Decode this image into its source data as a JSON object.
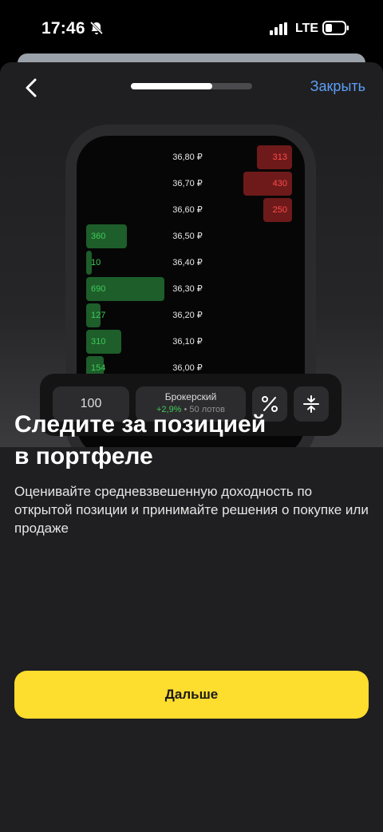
{
  "status_bar": {
    "time": "17:46",
    "network": "LTE"
  },
  "header": {
    "close_label": "Закрыть",
    "progress": 0.67
  },
  "order_book": {
    "rows": [
      {
        "price": "36,80 ₽",
        "side": "ask",
        "qty": "313"
      },
      {
        "price": "36,70 ₽",
        "side": "ask",
        "qty": "430"
      },
      {
        "price": "36,60 ₽",
        "side": "ask",
        "qty": "250"
      },
      {
        "price": "36,50 ₽",
        "side": "bid",
        "qty": "360"
      },
      {
        "price": "36,40 ₽",
        "side": "bid",
        "qty": "10"
      },
      {
        "price": "36,30 ₽",
        "side": "bid",
        "qty": "690"
      },
      {
        "price": "36,20 ₽",
        "side": "bid",
        "qty": "127"
      },
      {
        "price": "36,10 ₽",
        "side": "bid",
        "qty": "310"
      },
      {
        "price": "36,00 ₽",
        "side": "bid",
        "qty": "154"
      }
    ]
  },
  "toolbar": {
    "quantity": "100",
    "account_name": "Брокерский",
    "account_gain": "+2,9%",
    "account_lots": " • 50 лотов"
  },
  "content": {
    "title_line1": "Следите за позицией",
    "title_line2": "в портфеле",
    "description": "Оценивайте средневзвешенную доходность по открытой позиции и принимайте решения о покупке или продаже"
  },
  "next_button_label": "Дальше",
  "colors": {
    "accent_yellow": "#fddd2d",
    "link_blue": "#5d9ef5",
    "bid_green": "#41c95a",
    "ask_red": "#ff4b4b"
  }
}
